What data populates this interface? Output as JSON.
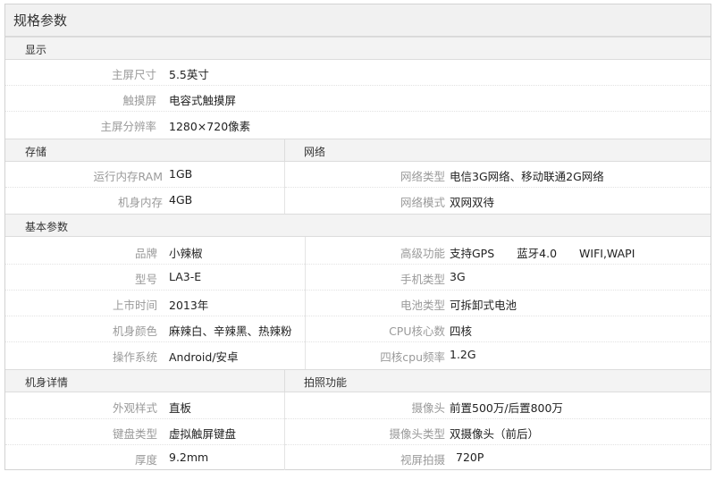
{
  "title": "规格参数",
  "sections": {
    "display": {
      "header": "显示",
      "rows": [
        {
          "label": "主屏尺寸",
          "value": "5.5英寸"
        },
        {
          "label": "触摸屏",
          "value": "电容式触摸屏"
        },
        {
          "label": "主屏分辨率",
          "value": "1280×720像素"
        }
      ]
    },
    "storage": {
      "header": "存储",
      "rows": [
        {
          "label": "运行内存RAM",
          "value": "1GB"
        },
        {
          "label": "机身内存",
          "value": "4GB"
        }
      ]
    },
    "network": {
      "header": "网络",
      "rows": [
        {
          "label": "网络类型",
          "value": "电信3G网络、移动联通2G网络"
        },
        {
          "label": "网络模式",
          "value": "双网双待"
        }
      ]
    },
    "basic": {
      "header": "基本参数",
      "left_rows": [
        {
          "label": "品牌",
          "value": "小辣椒"
        },
        {
          "label": "型号",
          "value": "LA3-E"
        },
        {
          "label": "上市时间",
          "value": "2013年"
        },
        {
          "label": "机身颜色",
          "value": "麻辣白、辛辣黑、热辣粉"
        },
        {
          "label": "操作系统",
          "value": "Android/安卓"
        }
      ],
      "right_rows": [
        {
          "label": "高级功能",
          "value": "支持GPS　　蓝牙4.0　　WIFI,WAPI"
        },
        {
          "label": "手机类型",
          "value": "3G"
        },
        {
          "label": "电池类型",
          "value": "可拆卸式电池"
        },
        {
          "label": "CPU核心数",
          "value": "四核"
        },
        {
          "label": "四核cpu频率",
          "value": "1.2G"
        }
      ]
    },
    "body": {
      "header": "机身详情",
      "rows": [
        {
          "label": "外观样式",
          "value": "直板"
        },
        {
          "label": "键盘类型",
          "value": "虚拟触屏键盘"
        },
        {
          "label": "厚度",
          "value": "9.2mm"
        }
      ]
    },
    "camera": {
      "header": "拍照功能",
      "rows": [
        {
          "label": "摄像头",
          "value": "前置500万/后置800万"
        },
        {
          "label": "摄像头类型",
          "value": "双摄像头（前后）"
        },
        {
          "label": "视屏拍摄",
          "value": "720P"
        }
      ]
    }
  }
}
